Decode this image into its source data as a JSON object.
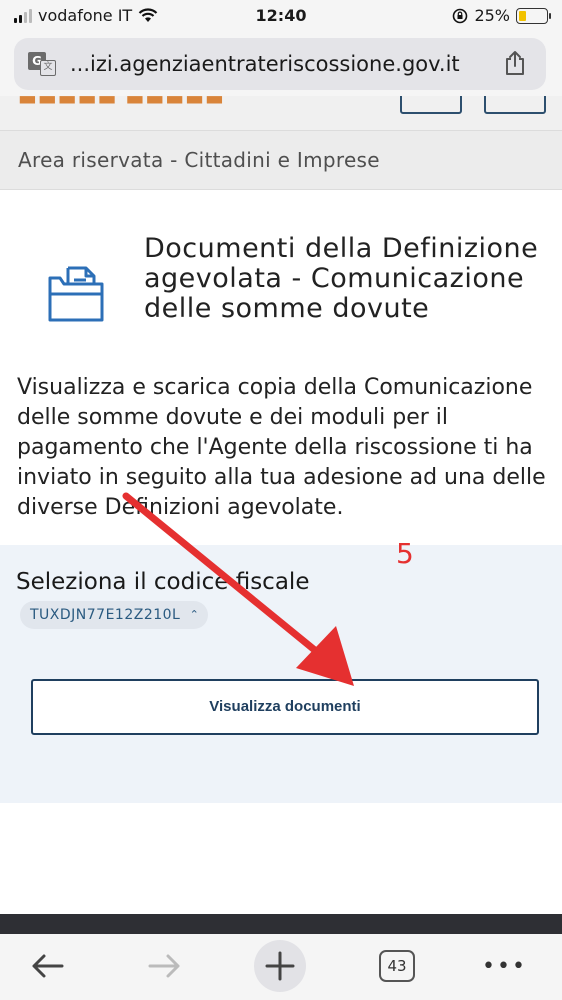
{
  "status_bar": {
    "carrier": "vodafone IT",
    "time": "12:40",
    "battery": "25%"
  },
  "browser": {
    "url": "...izi.agenziaentrateriscossione.gov.it",
    "tab_count": "43"
  },
  "breadcrumb": "Area riservata - Cittadini e Imprese",
  "page": {
    "title": "Documenti della Definizione agevolata - Comunicazione delle somme dovute",
    "description": "Visualizza e scarica copia della Comunicazione delle somme dovute e dei moduli per il pagamento che l'Agente della riscossione ti ha inviato in seguito alla tua adesione ad una delle diverse Definizioni agevolate."
  },
  "form": {
    "select_label": "Seleziona il codice fiscale",
    "fiscal_code_value": "TUXDJN77E12Z210L",
    "submit_label": "Visualizza documenti"
  },
  "annotation": {
    "step_number": "5",
    "color": "#e53030"
  },
  "colors": {
    "primary": "#1f3f5f",
    "panel_bg": "#eef3f9",
    "icon_blue": "#2c6fb7"
  },
  "icons": [
    "translate-icon",
    "share-icon",
    "folder-document-icon",
    "back-arrow-icon",
    "forward-arrow-icon",
    "plus-icon",
    "tabs-icon",
    "more-icon",
    "wifi-icon",
    "lock-rotation-icon",
    "battery-icon"
  ]
}
